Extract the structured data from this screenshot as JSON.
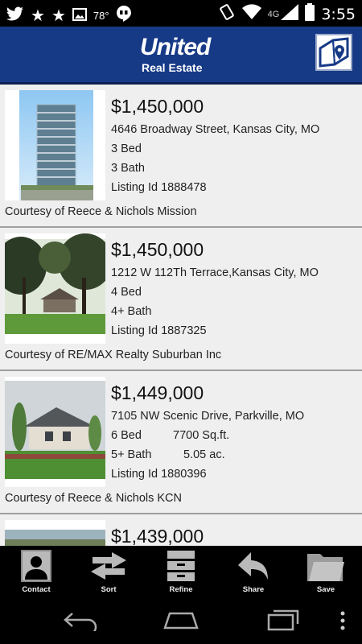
{
  "status_bar": {
    "temperature": "78°",
    "network": "4G",
    "time": "3:55"
  },
  "brand": {
    "name_top": "United",
    "name_bottom": "Real Estate"
  },
  "listings": [
    {
      "price": "$1,450,000",
      "address": "4646 Broadway Street, Kansas City, MO",
      "beds": "3 Bed",
      "baths": "3 Bath",
      "listing_id": "Listing Id 1888478",
      "courtesy": "Courtesy of Reece & Nichols Mission"
    },
    {
      "price": "$1,450,000",
      "address": "1212 W 112Th Terrace,Kansas City, MO",
      "beds": "4 Bed",
      "baths": "4+ Bath",
      "listing_id": "Listing Id 1887325",
      "courtesy": "Courtesy of RE/MAX Realty Suburban Inc"
    },
    {
      "price": "$1,449,000",
      "address": "7105 NW Scenic Drive, Parkville, MO",
      "beds": "6 Bed",
      "sqft": "7700 Sq.ft.",
      "baths": "5+ Bath",
      "acres": "5.05 ac.",
      "listing_id": "Listing Id 1880396",
      "courtesy": "Courtesy of Reece & Nichols KCN"
    },
    {
      "price": "$1,439,000"
    }
  ],
  "tabs": [
    {
      "label": "Contact",
      "icon": "contact-icon"
    },
    {
      "label": "Sort",
      "icon": "sort-icon"
    },
    {
      "label": "Refine",
      "icon": "refine-icon"
    },
    {
      "label": "Share",
      "icon": "share-icon"
    },
    {
      "label": "Save",
      "icon": "save-icon"
    }
  ]
}
